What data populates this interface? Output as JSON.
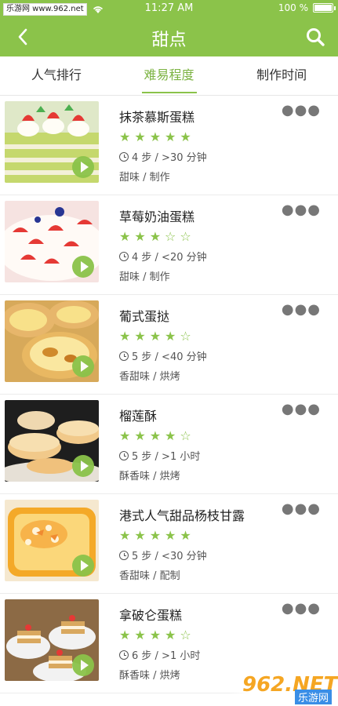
{
  "status": {
    "site": "乐游网 www.962.net",
    "time": "11:27 AM",
    "battery": "100 %",
    "battery_level": 1.0
  },
  "header": {
    "title": "甜点",
    "back_icon": "chevron-left-icon",
    "search_icon": "search-icon"
  },
  "tabs": [
    {
      "label": "人气排行",
      "active": false
    },
    {
      "label": "难易程度",
      "active": true
    },
    {
      "label": "制作时间",
      "active": false
    }
  ],
  "colors": {
    "accent": "#8bc34a",
    "text": "#333333"
  },
  "items": [
    {
      "name": "抹茶慕斯蛋糕",
      "rating": 5,
      "steps": "4 步 / >30 分钟",
      "tags": "甜味 / 制作"
    },
    {
      "name": "草莓奶油蛋糕",
      "rating": 3,
      "steps": "4 步 / <20 分钟",
      "tags": "甜味 / 制作"
    },
    {
      "name": "葡式蛋挞",
      "rating": 4,
      "steps": "5 步 / <40 分钟",
      "tags": "香甜味 / 烘烤"
    },
    {
      "name": "榴莲酥",
      "rating": 4,
      "steps": "5 步 / >1 小时",
      "tags": "酥香味 / 烘烤"
    },
    {
      "name": "港式人气甜品杨枝甘露",
      "rating": 5,
      "steps": "5 步 / <30 分钟",
      "tags": "香甜味 / 配制"
    },
    {
      "name": "拿破仑蛋糕",
      "rating": 4,
      "steps": "6 步 / >1 小时",
      "tags": "酥香味 / 烘烤"
    }
  ],
  "watermark": {
    "logo": "962.NET",
    "sub": "乐游网"
  }
}
